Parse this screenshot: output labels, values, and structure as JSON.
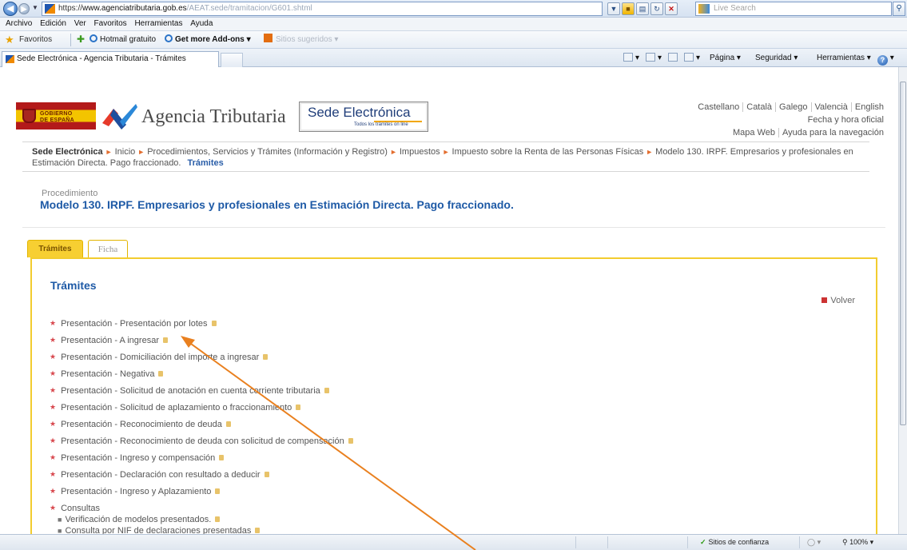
{
  "browser": {
    "url_prefix": "https://",
    "url_host": "www.agenciatributaria.gob.es",
    "url_path": "/AEAT.sede/tramitacion/G601.shtml",
    "search_placeholder": "Live Search",
    "menu": [
      "Archivo",
      "Edición",
      "Ver",
      "Favoritos",
      "Herramientas",
      "Ayuda"
    ],
    "favorites_label": "Favoritos",
    "fav_links": [
      "Hotmail gratuito",
      "Get more Add-ons",
      "Sitios sugeridos"
    ],
    "tab_title": "Sede Electrónica - Agencia Tributaria - Trámites",
    "commands": [
      "Página",
      "Seguridad",
      "Herramientas"
    ],
    "status_zone": "Sitios de confianza",
    "zoom": "100%"
  },
  "header": {
    "gov_line1": "GOBIERNO",
    "gov_line2": "DE ESPAÑA",
    "agency_name": "Agencia Tributaria",
    "sede_title": "Sede Electrónica",
    "sede_sub": "Todos los trámites on line",
    "languages": [
      "Castellano",
      "Català",
      "Galego",
      "Valencià",
      "English"
    ],
    "fecha": "Fecha y hora oficial",
    "mapa_web": "Mapa Web",
    "ayuda_nav": "Ayuda para la navegación"
  },
  "breadcrumb": {
    "items": [
      "Sede Electrónica",
      "Inicio",
      "Procedimientos, Servicios y Trámites (Información y Registro)",
      "Impuestos",
      "Impuesto sobre la Renta de las Personas Físicas",
      "Modelo 130. IRPF. Empresarios y profesionales en Estimación Directa. Pago fraccionado."
    ],
    "current": "Trámites"
  },
  "procedure": {
    "label": "Procedimiento",
    "title": "Modelo 130. IRPF. Empresarios y profesionales en Estimación Directa. Pago fraccionado."
  },
  "tabs": [
    {
      "label": "Trámites",
      "active": true
    },
    {
      "label": "Ficha",
      "active": false
    }
  ],
  "tramites": {
    "heading": "Trámites",
    "volver": "Volver",
    "items": [
      "Presentación - Presentación por lotes",
      "Presentación - A ingresar",
      "Presentación - Domiciliación del importe a ingresar",
      "Presentación - Negativa",
      "Presentación - Solicitud de anotación en cuenta corriente tributaria",
      "Presentación - Solicitud de aplazamiento o fraccionamiento",
      "Presentación - Reconocimiento de deuda",
      "Presentación - Reconocimiento de deuda con solicitud de compensación",
      "Presentación - Ingreso y compensación",
      "Presentación - Declaración con resultado a deducir",
      "Presentación - Ingreso y Aplazamiento"
    ],
    "consultas_label": "Consultas",
    "consultas": [
      "Verificación de modelos presentados.",
      "Consulta por NIF de declaraciones presentadas"
    ]
  },
  "colors": {
    "accent_blue": "#1e5aa6",
    "tab_yellow": "#f7cf32",
    "annotation_arrow": "#e9801f"
  }
}
